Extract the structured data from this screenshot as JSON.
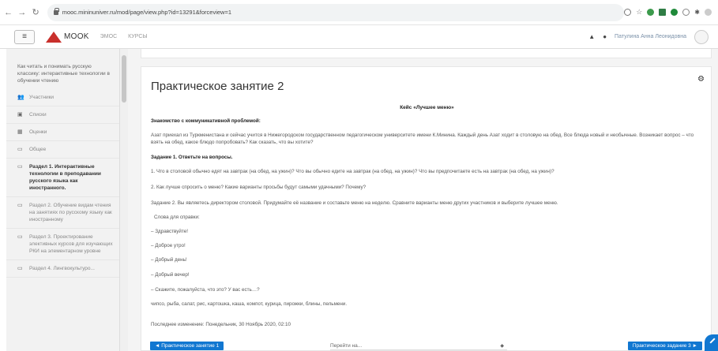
{
  "browser": {
    "url": "mooc.mininuniver.ru/mod/page/view.php?id=13291&forceview=1"
  },
  "navbar": {
    "logo": "MOOK",
    "links": [
      "ЭМОС",
      "КУРСЫ"
    ],
    "user_name": "Патулина Анна Леонидовна"
  },
  "sidebar": {
    "course_title": "Как читать и понимать русскую классику: интерактивные технологии в обучении чтению",
    "items": [
      {
        "icon": "users-icon",
        "glyph": "👥",
        "label": "Участники",
        "bold": false
      },
      {
        "icon": "badge-icon",
        "glyph": "▣",
        "label": "Списки",
        "bold": false
      },
      {
        "icon": "grades-icon",
        "glyph": "▦",
        "label": "Оценки",
        "bold": false
      },
      {
        "icon": "folder-icon",
        "glyph": "▭",
        "label": "Общее",
        "bold": false
      },
      {
        "icon": "folder-icon",
        "glyph": "▭",
        "label": "Раздел 1. Интерактивные технологии в преподавании русского языка как иностранного.",
        "bold": true
      },
      {
        "icon": "folder-icon",
        "glyph": "▭",
        "label": "Раздел 2. Обучение видам чтения на занятиях по русскому языку как иностранному",
        "bold": false
      },
      {
        "icon": "folder-icon",
        "glyph": "▭",
        "label": "Раздел 3. Проектирование элективных курсов для изучающих РКИ на элементарном уровне",
        "bold": false
      },
      {
        "icon": "folder-icon",
        "glyph": "▭",
        "label": "Раздел 4. Лингвокультуро...",
        "bold": false
      }
    ]
  },
  "content": {
    "title": "Практическое занятие 2",
    "case_title": "Кейс «Лучшее меню»",
    "heading1": "Знакомство с коммуникативной проблемой:",
    "intro": "Азат приехал из Туркменистана и сейчас учится в Нижегородском государственном педагогическом университете имени К.Минина. Каждый день Азат ходит в столовую на обед. Все блюда новый и необычные. Возникает вопрос – что взять на обед, какое блюдо попробовать? Как сказать, что вы хотите?",
    "task1": "Задание 1. Ответьте на вопросы.",
    "q1": "1. Что в столовой обычно едят на завтрак (на обед, на ужин)? Что вы обычно едите на завтрак (на обед, на ужин)? Что вы предпочитаете есть на завтрак (на обед, на ужин)?",
    "q2": "2. Как лучше спросить о меню? Какие варианты просьбы будут самыми удачными? Почему?",
    "task2": "Задание 2. Вы являетесь директором столовой. Придумайте её название и составьте меню на неделю. Сравните варианты меню других участников и выберите лучшее меню.",
    "ref_words": "Слова для справки:",
    "phrases": [
      "– Здравствуйте!",
      "– Доброе утро!",
      "– Добрый день!",
      "– Добрый вечер!",
      "– Скажите, пожалуйста, что это? У вас есть…?"
    ],
    "food": "чипсо, рыба, салат, рис, картошка, каша, компот, курица, пирожки, блины, пельмени.",
    "last_modified": "Последнее изменение: Понедельник, 30 Ноябрь 2020, 02:10"
  },
  "bottom": {
    "prev": "◄ Практическое занятие 1",
    "jump": "Перейти на...",
    "next": "Практическое задание 3 ►"
  }
}
